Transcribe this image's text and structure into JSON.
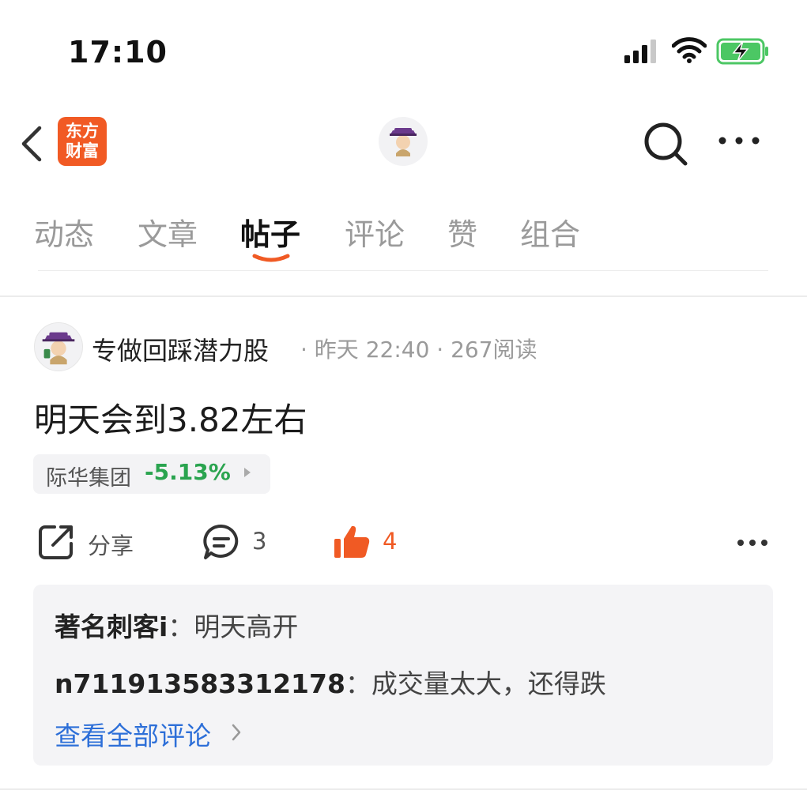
{
  "status_bar": {
    "time": "17:10"
  },
  "nav": {
    "brand_line1": "东方",
    "brand_line2": "财富",
    "brand_color": "#f15a24"
  },
  "tabs": [
    {
      "label": "动态",
      "active": false
    },
    {
      "label": "文章",
      "active": false
    },
    {
      "label": "帖子",
      "active": true
    },
    {
      "label": "评论",
      "active": false
    },
    {
      "label": "赞",
      "active": false
    },
    {
      "label": "组合",
      "active": false
    }
  ],
  "post": {
    "author": "专做回踩潜力股",
    "meta": "· 昨天 22:40 · 267阅读",
    "content": "明天会到3.82左右",
    "stock": {
      "name": "际华集团",
      "change": "-5.13%",
      "change_color": "#2aa44f"
    },
    "actions": {
      "share_label": "分享",
      "comment_count": "3",
      "like_count": "4",
      "like_color": "#f05a24"
    },
    "comments": [
      {
        "user": "著名刺客i",
        "sep": "：",
        "text": "明天高开"
      },
      {
        "user": "n711913583312178",
        "sep": "：",
        "text": "成交量太大，还得跌"
      }
    ],
    "view_all": "查看全部评论"
  }
}
